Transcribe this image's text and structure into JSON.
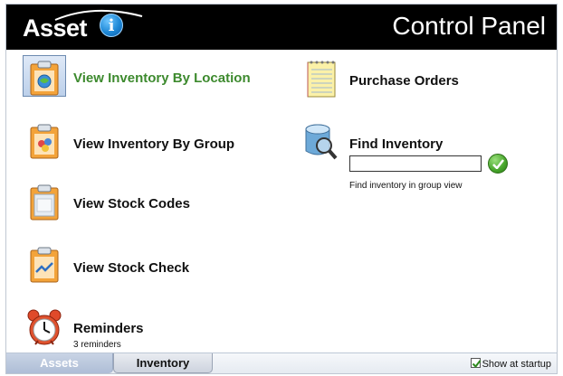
{
  "header": {
    "logo_text": "Asset",
    "logo_badge": "i",
    "title": "Control Panel"
  },
  "left_items": [
    {
      "label": "View Inventory By Location",
      "icon": "location-clipboard-icon",
      "active": true
    },
    {
      "label": "View Inventory By Group",
      "icon": "group-clipboard-icon"
    },
    {
      "label": "View Stock Codes",
      "icon": "clipboard-icon"
    },
    {
      "label": "View Stock Check",
      "icon": "stock-check-clipboard-icon"
    },
    {
      "label": "Reminders",
      "sublabel": "3 reminders",
      "icon": "alarm-clock-icon"
    }
  ],
  "right_items": [
    {
      "label": "Purchase Orders",
      "icon": "notepad-icon"
    },
    {
      "label": "Find Inventory",
      "icon": "database-search-icon"
    }
  ],
  "find": {
    "value": "",
    "hint": "Find inventory in group view",
    "go_icon": "checkmark-icon"
  },
  "tabs": [
    {
      "label": "Assets",
      "selected": false
    },
    {
      "label": "Inventory",
      "selected": true
    }
  ],
  "startup": {
    "label": "Show at startup",
    "checked": true
  },
  "colors": {
    "header_bg": "#000000",
    "active_label": "#3d8a2e",
    "accent_blue": "#1e88d6",
    "go_green": "#46a52a"
  }
}
